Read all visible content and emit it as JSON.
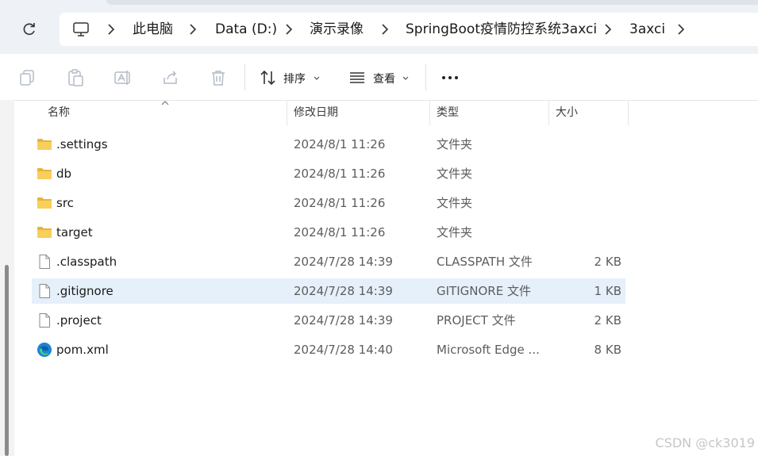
{
  "breadcrumb": [
    "此电脑",
    "Data (D:)",
    "演示录像",
    "SpringBoot疫情防控系统3axci",
    "3axci"
  ],
  "toolbar": {
    "sort_label": "排序",
    "view_label": "查看",
    "more_label": "···"
  },
  "columns": {
    "name": "名称",
    "date": "修改日期",
    "type": "类型",
    "size": "大小"
  },
  "files": [
    {
      "name": ".settings",
      "date": "2024/8/1 11:26",
      "type": "文件夹",
      "size": "",
      "icon": "folder-icon"
    },
    {
      "name": "db",
      "date": "2024/8/1 11:26",
      "type": "文件夹",
      "size": "",
      "icon": "folder-icon"
    },
    {
      "name": "src",
      "date": "2024/8/1 11:26",
      "type": "文件夹",
      "size": "",
      "icon": "folder-icon"
    },
    {
      "name": "target",
      "date": "2024/8/1 11:26",
      "type": "文件夹",
      "size": "",
      "icon": "folder-icon"
    },
    {
      "name": ".classpath",
      "date": "2024/7/28 14:39",
      "type": "CLASSPATH 文件",
      "size": "2 KB",
      "icon": "file-icon"
    },
    {
      "name": ".gitignore",
      "date": "2024/7/28 14:39",
      "type": "GITIGNORE 文件",
      "size": "1 KB",
      "icon": "file-icon",
      "selected": true
    },
    {
      "name": ".project",
      "date": "2024/7/28 14:39",
      "type": "PROJECT 文件",
      "size": "2 KB",
      "icon": "file-icon"
    },
    {
      "name": "pom.xml",
      "date": "2024/7/28 14:40",
      "type": "Microsoft Edge ...",
      "size": "8 KB",
      "icon": "edge-icon"
    }
  ],
  "watermark": "CSDN @ck3019",
  "colors": {
    "accent": "#e5f0fb",
    "folder": "#f4c542",
    "chrome_bg": "#eef2f7"
  }
}
